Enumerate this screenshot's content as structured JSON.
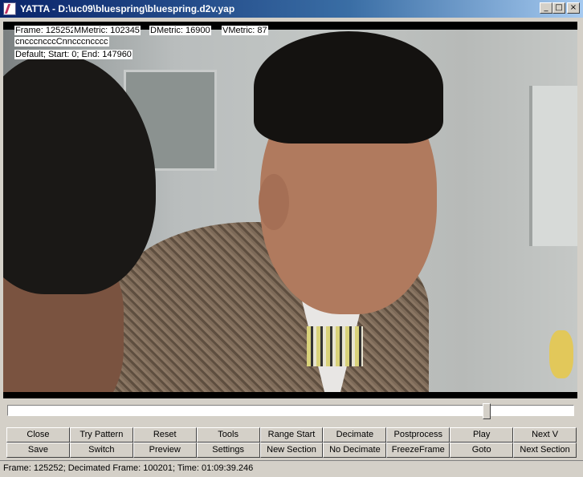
{
  "window": {
    "title": "YATTA - D:\\uc09\\bluespring\\bluespring.d2v.yap"
  },
  "overlay": {
    "frame": "Frame: 125252",
    "mmetric": "MMetric: 102345",
    "dmetric": "DMetric: 16900",
    "vmetric": "VMetric: 87",
    "pattern": "cncccncccCnncccncccc",
    "section": "Default; Start: 0; End: 147960"
  },
  "slider": {
    "position_fraction": 0.846,
    "min": 0,
    "max": 147960,
    "value": 125252
  },
  "buttons": {
    "row1": [
      "Close",
      "Try Pattern",
      "Reset",
      "Tools",
      "Range Start",
      "Decimate",
      "Postprocess",
      "Play",
      "Next V"
    ],
    "row2": [
      "Save",
      "Switch",
      "Preview",
      "Settings",
      "New Section",
      "No Decimate",
      "FreezeFrame",
      "Goto",
      "Next Section"
    ]
  },
  "status": {
    "text": "Frame: 125252; Decimated Frame: 100201; Time: 01:09:39.246"
  },
  "colors": {
    "titlebar_start": "#0a246a",
    "titlebar_end": "#a6caf0",
    "face": "#d4d0c8"
  }
}
